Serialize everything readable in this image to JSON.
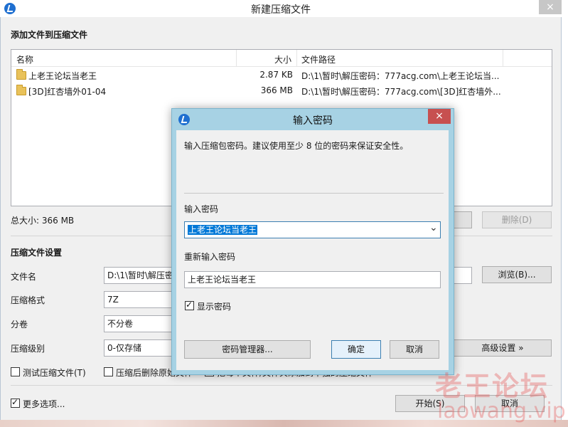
{
  "main": {
    "title": "新建压缩文件",
    "close_icon": "×",
    "add_section": "添加文件到压缩文件",
    "columns": {
      "name": "名称",
      "size": "大小",
      "path": "文件路径"
    },
    "files": [
      {
        "name": "上老王论坛当老王",
        "size": "2.87 KB",
        "path": "D:\\1\\暂时\\解压密码：777acg.com\\上老王论坛当..."
      },
      {
        "name": "[3D]红杏墙外01-04",
        "size": "366 MB",
        "path": "D:\\1\\暂时\\解压密码：777acg.com\\[3D]红杏墙外..."
      }
    ],
    "total_size": "总大小: 366 MB",
    "delete_button": "删除(D)",
    "settings_section": "压缩文件设置",
    "filename_label": "文件名",
    "filename_value": "D:\\1\\暂时\\解压密",
    "browse_button": "浏览(B)...",
    "format_label": "压缩格式",
    "format_value": "7Z",
    "volume_label": "分卷",
    "volume_value": "不分卷",
    "level_label": "压缩级别",
    "level_value": "0-仅存储",
    "advanced_button": "高级设置 »",
    "test_checkbox": "测试压缩文件(T)",
    "delete_after_checkbox": "压缩后删除原始文件",
    "each_folder_checkbox": "把每个文件/文件夹添加到单独的压缩文件",
    "more_options": "更多选项...",
    "start_button": "开始(S)",
    "cancel_button": "取消"
  },
  "dialog": {
    "title": "输入密码",
    "close_icon": "×",
    "hint": "输入压缩包密码。建议使用至少 8 位的密码来保证安全性。",
    "password_label": "输入密码",
    "password_value": "上老王论坛当老王",
    "dropdown_icon": "⌄",
    "reenter_label": "重新输入密码",
    "reenter_value": "上老王论坛当老王",
    "show_password": "显示密码",
    "manager_button": "密码管理器...",
    "ok_button": "确定",
    "cancel_button": "取消"
  },
  "watermark": {
    "cn": "老王论坛",
    "en": "laowang.vip"
  },
  "colors": {
    "accent": "#0078d7",
    "dialog_frame": "#a7d2e4",
    "close_red": "#c75050",
    "app_icon": "#1f6fd0"
  }
}
